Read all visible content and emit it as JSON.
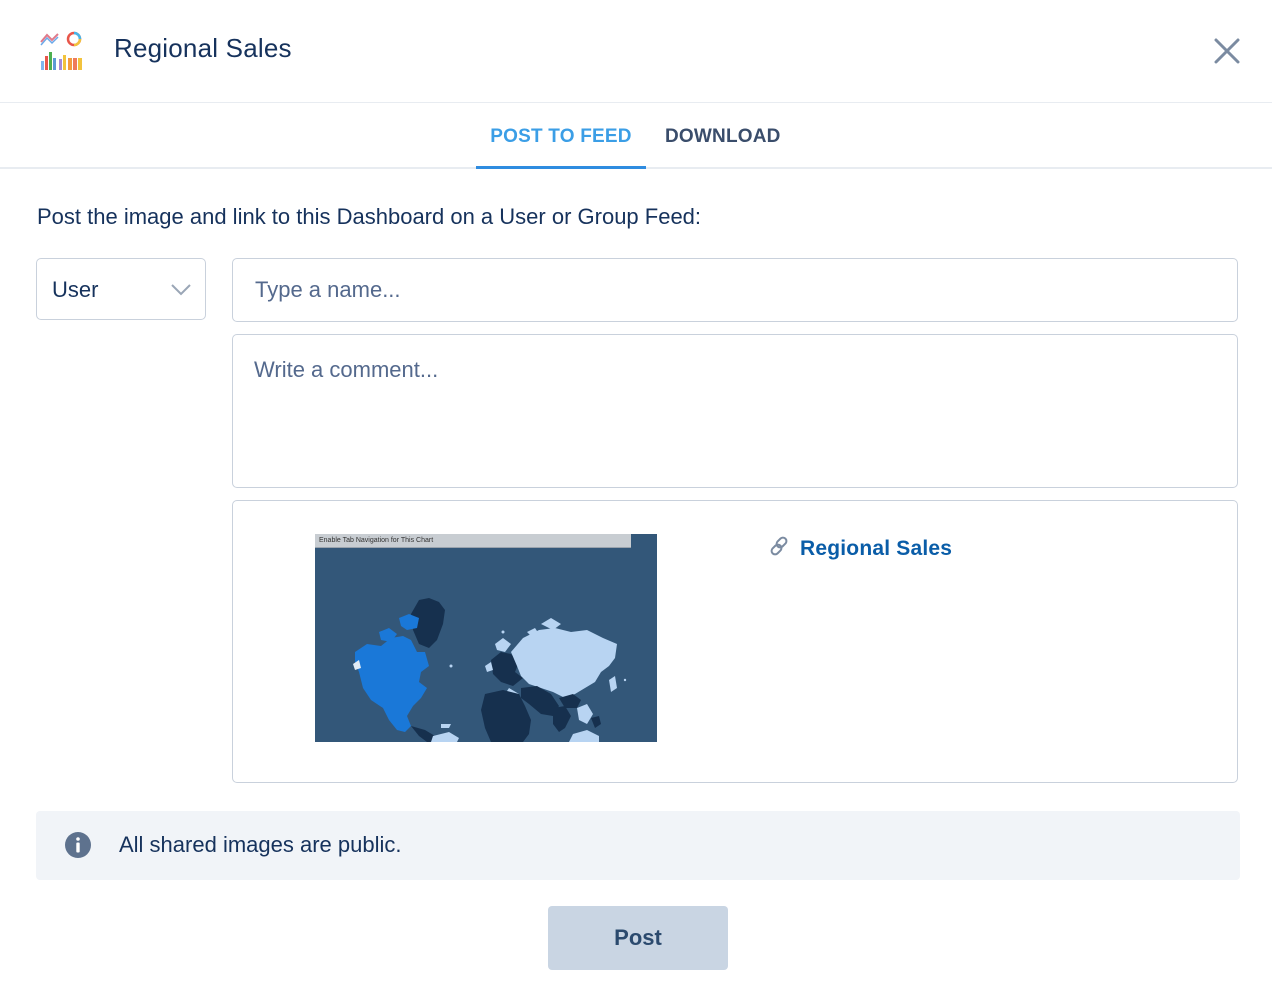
{
  "header": {
    "title": "Regional Sales",
    "app_icon": "dashboard-chart-icon",
    "close_icon": "close-icon"
  },
  "tabs": [
    {
      "label": "POST TO FEED",
      "active": true
    },
    {
      "label": "DOWNLOAD",
      "active": false
    }
  ],
  "form": {
    "instructions": "Post the image and link to this Dashboard on a User or Group Feed:",
    "feed_type": {
      "value": "User",
      "icon": "chevron-down-icon"
    },
    "name_input": {
      "value": "",
      "placeholder": "Type a name..."
    },
    "comment_input": {
      "value": "",
      "placeholder": "Write a comment..."
    }
  },
  "preview": {
    "thumbnail_banner": "Enable Tab Navigation for This Chart",
    "link_label": "Regional Sales",
    "link_icon": "link-icon"
  },
  "notice": {
    "icon": "info-icon",
    "text": "All shared images are public."
  },
  "actions": {
    "post_label": "Post"
  },
  "colors": {
    "active_tab": "#3b9ee6",
    "link": "#0a5da8",
    "text": "#16325c",
    "map_ocean": "#335779",
    "map_high": "#1a78d8",
    "map_mid": "#b8d4f2",
    "map_low": "#16304e"
  }
}
